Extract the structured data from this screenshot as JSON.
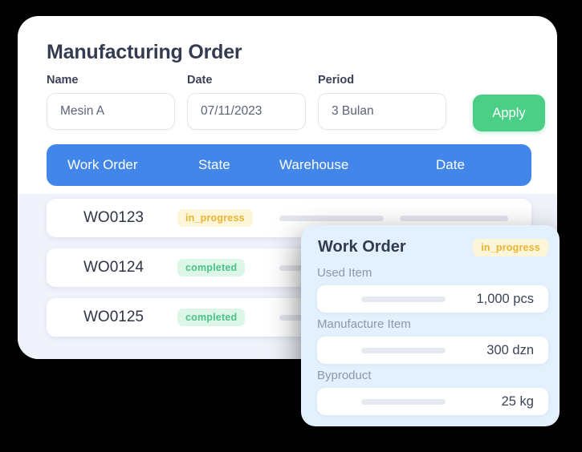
{
  "panel": {
    "title": "Manufacturing Order"
  },
  "filters": {
    "name": {
      "label": "Name",
      "value": "Mesin A"
    },
    "date": {
      "label": "Date",
      "value": "07/11/2023"
    },
    "period": {
      "label": "Period",
      "value": "3 Bulan"
    },
    "apply_label": "Apply"
  },
  "table": {
    "columns": [
      "Work Order",
      "State",
      "Warehouse",
      "Date"
    ],
    "rows": [
      {
        "work_order": "WO0123",
        "state": "in_progress",
        "warehouse": "",
        "date": ""
      },
      {
        "work_order": "WO0124",
        "state": "completed",
        "warehouse": "",
        "date": ""
      },
      {
        "work_order": "WO0125",
        "state": "completed",
        "warehouse": "",
        "date": ""
      }
    ]
  },
  "detail_card": {
    "title": "Work Order",
    "state": "in_progress",
    "items": [
      {
        "label": "Used Item",
        "value": "1,000 pcs"
      },
      {
        "label": "Manufacture Item",
        "value": "300 dzn"
      },
      {
        "label": "Byproduct",
        "value": "25 kg"
      }
    ]
  },
  "colors": {
    "accent_blue": "#4286e9",
    "apply_green": "#4bce86",
    "badge_in_progress_bg": "#fdf5d8",
    "badge_in_progress_text": "#e8b530",
    "badge_completed_bg": "#dcf7e7",
    "badge_completed_text": "#4cc188",
    "card_bg": "#e3f0fd"
  }
}
